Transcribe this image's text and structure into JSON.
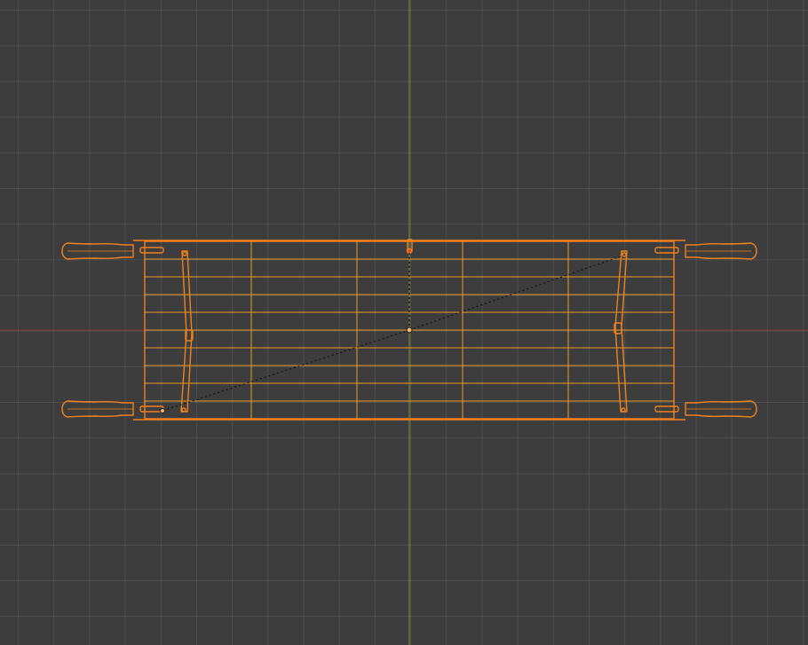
{
  "viewport": {
    "view": "top-orthographic",
    "grid": true,
    "background_color": "#3d3d3d",
    "grid_color": "#4a4a4a",
    "axis_x_color": "#8b3a3a",
    "axis_y_color": "#6e8b2e"
  },
  "selection": {
    "object": "stretcher",
    "display": "wireframe",
    "selected": true,
    "wire_color": "#f0821e",
    "wire_inner_color": "#e89a2c"
  },
  "origin": {
    "icon": "origin-dot-icon",
    "color": "#f5b56a"
  },
  "relationship_lines": {
    "style": "dashed",
    "color": "#111111"
  }
}
